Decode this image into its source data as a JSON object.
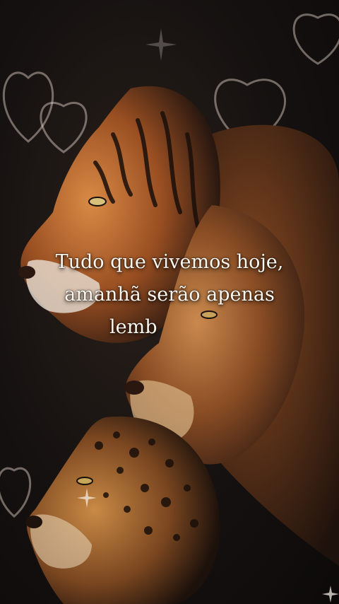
{
  "caption": {
    "line1": "Tudo que vivemos hoje,",
    "line2": "amanhã serão apenas",
    "line3": "lemb"
  },
  "colors": {
    "background": "#120e0c",
    "caption_text": "#fbf6ef",
    "tiger_fur": "#b4622a",
    "lion_mane": "#7a3f1c",
    "leopard_fur": "#8a5428",
    "heart_outline": "#e8d6cc"
  },
  "scene": {
    "subjects": [
      "tiger",
      "lion",
      "leopard"
    ],
    "decorations": [
      "heart-outlines",
      "sparkles"
    ]
  }
}
